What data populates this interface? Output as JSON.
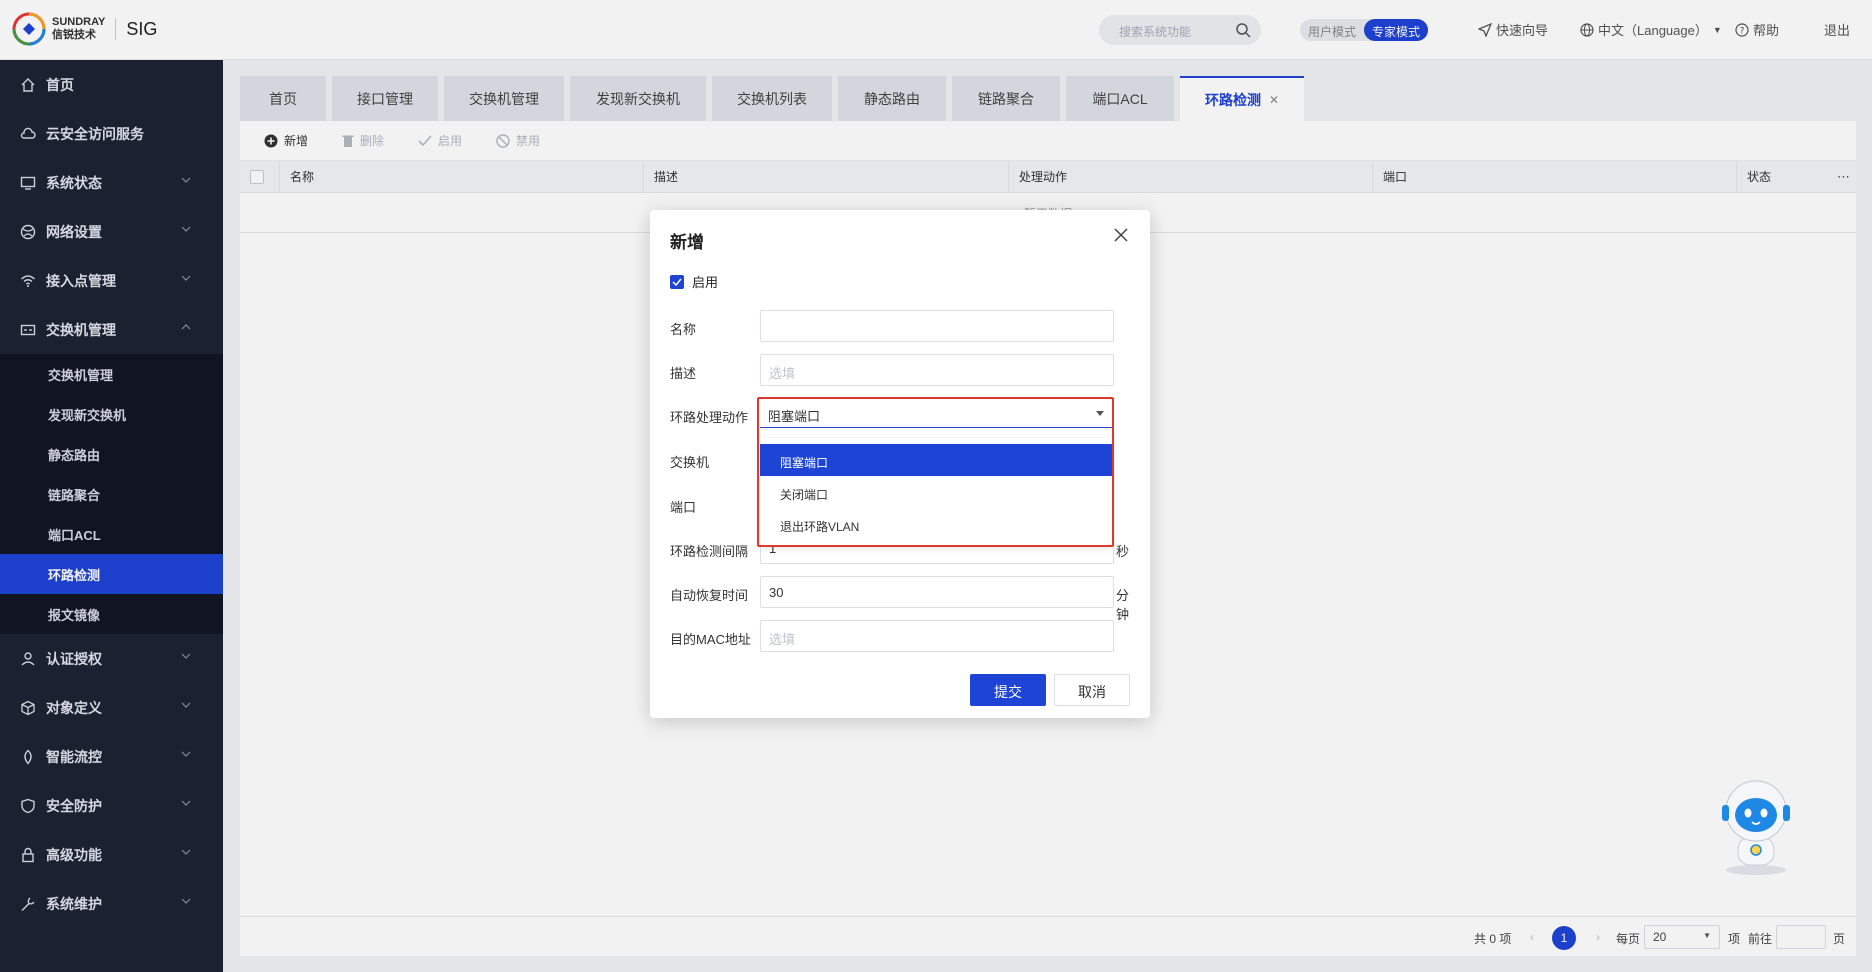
{
  "header": {
    "brand_en": "SUNDRAY",
    "brand_cn": "信锐技术",
    "product": "SIG",
    "search_placeholder": "搜索系统功能",
    "mode_user": "用户模式",
    "mode_expert": "专家模式",
    "quick_guide": "快速向导",
    "language": "中文（Language）",
    "help": "帮助",
    "logout": "退出"
  },
  "sidebar": {
    "items": [
      {
        "label": "首页",
        "icon": "home-icon"
      },
      {
        "label": "云安全访问服务",
        "icon": "cloud-icon"
      },
      {
        "label": "系统状态",
        "icon": "monitor-icon"
      },
      {
        "label": "网络设置",
        "icon": "globe-icon"
      },
      {
        "label": "接入点管理",
        "icon": "wifi-icon"
      },
      {
        "label": "交换机管理",
        "icon": "switch-icon"
      }
    ],
    "sub_items": [
      "交换机管理",
      "发现新交换机",
      "静态路由",
      "链路聚合",
      "端口ACL",
      "环路检测",
      "报文镜像"
    ],
    "active_sub": "环路检测",
    "items_after": [
      {
        "label": "认证授权",
        "icon": "user-icon"
      },
      {
        "label": "对象定义",
        "icon": "cube-icon"
      },
      {
        "label": "智能流控",
        "icon": "flow-icon"
      },
      {
        "label": "安全防护",
        "icon": "shield-icon"
      },
      {
        "label": "高级功能",
        "icon": "lock-icon"
      },
      {
        "label": "系统维护",
        "icon": "wrench-icon"
      }
    ]
  },
  "tabs": [
    "首页",
    "接口管理",
    "交换机管理",
    "发现新交换机",
    "交换机列表",
    "静态路由",
    "链路聚合",
    "端口ACL",
    "环路检测"
  ],
  "active_tab": "环路检测",
  "toolbar": {
    "add": "新增",
    "delete": "删除",
    "enable": "启用",
    "disable": "禁用"
  },
  "table": {
    "columns": [
      "名称",
      "描述",
      "处理动作",
      "端口",
      "状态"
    ],
    "no_data": "暂无数据"
  },
  "pagination": {
    "total": "共 0 项",
    "current_page": "1",
    "per_page_label": "每页",
    "per_page_value": "20",
    "items_label": "项",
    "goto_label": "前往",
    "page_label": "页"
  },
  "modal": {
    "title": "新增",
    "enable_label": "启用",
    "fields": {
      "name_label": "名称",
      "name_value": "",
      "desc_label": "描述",
      "desc_placeholder": "选填",
      "action_label": "环路处理动作",
      "action_value": "阻塞端口",
      "switch_label": "交换机",
      "port_label": "端口",
      "interval_label": "环路检测间隔",
      "interval_value": "1",
      "interval_unit": "秒",
      "recover_label": "自动恢复时间",
      "recover_value": "30",
      "recover_unit": "分钟",
      "mac_label": "目的MAC地址",
      "mac_placeholder": "选填"
    },
    "dropdown_options": [
      "阻塞端口",
      "关闭端口",
      "退出环路VLAN"
    ],
    "submit": "提交",
    "cancel": "取消"
  },
  "colors": {
    "primary": "#1e44d6",
    "sidebar_bg": "#1d2333",
    "highlight": "#e0392c"
  }
}
